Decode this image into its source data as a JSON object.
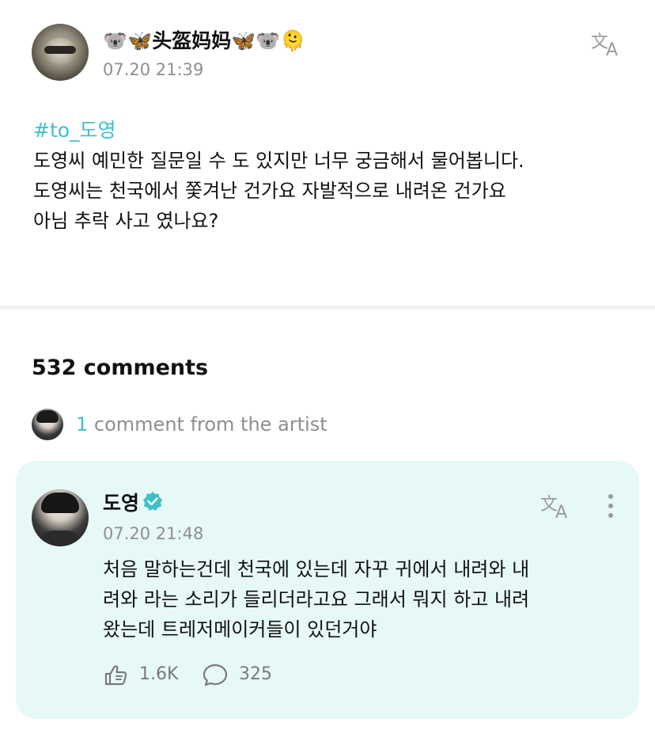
{
  "post": {
    "author_name": "🐨🦋头盔妈妈🦋🐨🫠",
    "time": "07.20 21:39",
    "hashtag": "#to_도영",
    "lines": [
      "도영씨 예민한 질문일 수 도 있지만 너무 궁금해서 물어봅니다.",
      "도영씨는 천국에서 쫓겨난 건가요 자발적으로 내려온 건가요",
      "아님 추락 사고 였나요?"
    ]
  },
  "comments": {
    "count_label": "532 comments",
    "artist_count": "1",
    "artist_label": "comment from the artist"
  },
  "artist_comment": {
    "name": "도영",
    "time": "07.20 21:48",
    "lines": [
      "처음 말하는건데 천국에 있는데 자꾸 귀에서 내려와 내",
      "려와 라는 소리가 들리더라고요 그래서 뭐지 하고 내려",
      "왔는데 트레저메이커들이 있던거야"
    ],
    "likes": "1.6K",
    "replies": "325"
  },
  "colors": {
    "accent": "#3fc0c7",
    "card_bg": "#e7f9f6",
    "muted": "#8e8e93"
  },
  "icons": {
    "translate": "translate-icon",
    "verified": "verified-badge-icon",
    "more": "more-vertical-icon",
    "like": "like-hand-icon",
    "comment": "comment-bubble-icon"
  }
}
